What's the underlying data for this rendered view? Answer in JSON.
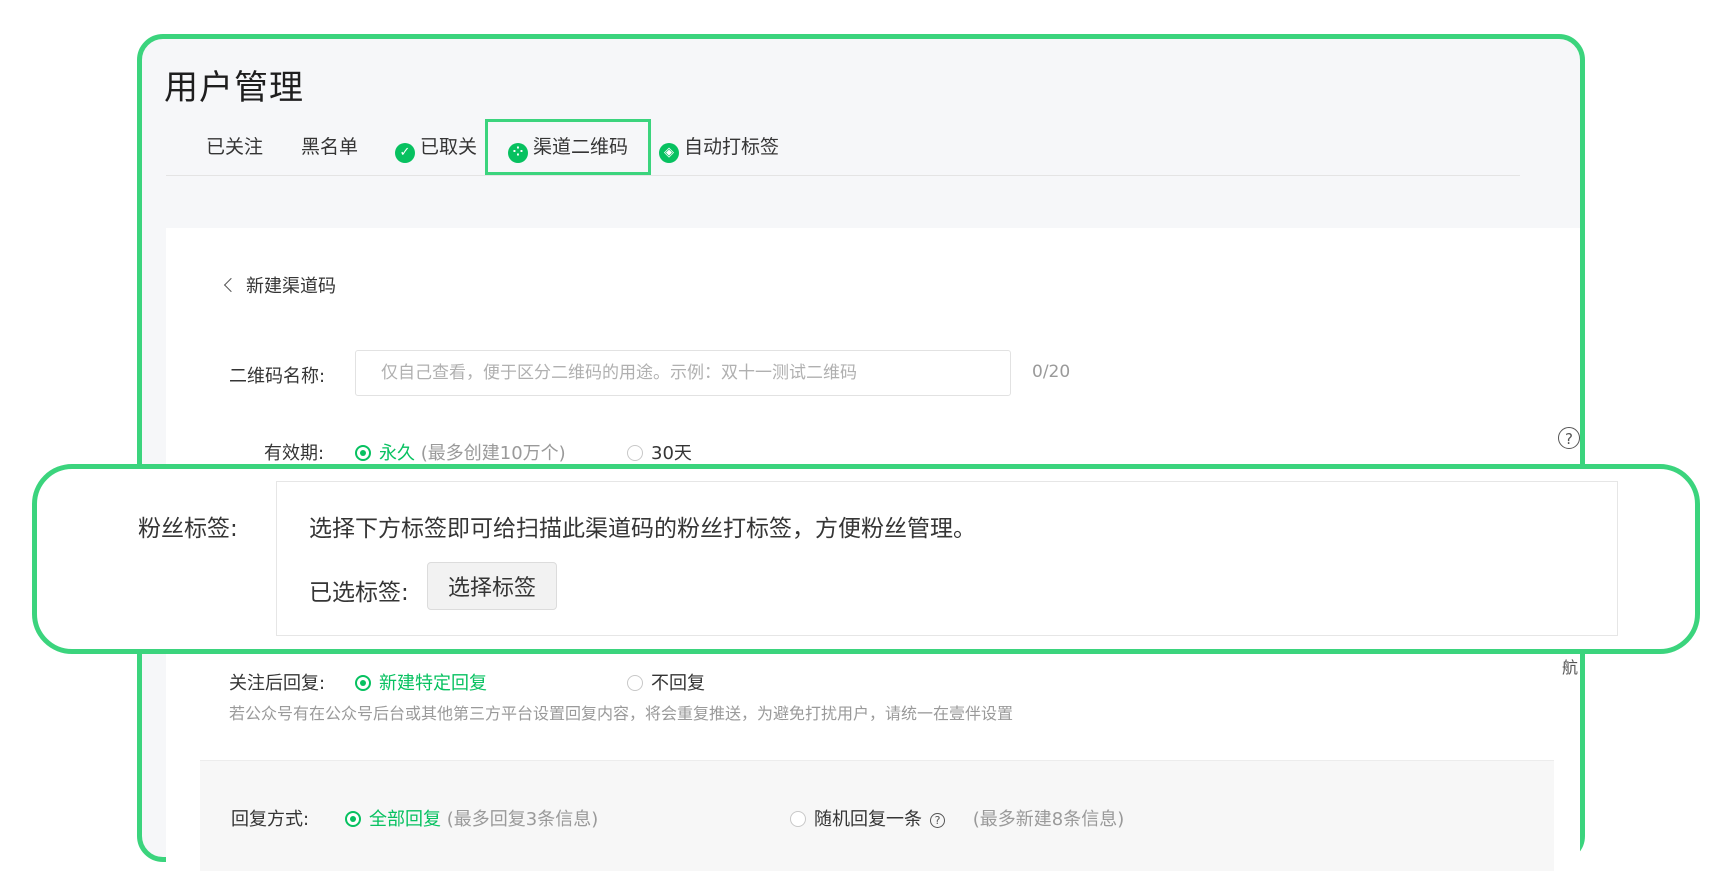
{
  "page": {
    "title": "用户管理"
  },
  "tabs": [
    {
      "label": "已关注",
      "icon": ""
    },
    {
      "label": "黑名单",
      "icon": ""
    },
    {
      "label": "已取关",
      "icon": "check-badge-icon"
    },
    {
      "label": "渠道二维码",
      "icon": "qr-grid-icon"
    },
    {
      "label": "自动打标签",
      "icon": "tag-icon"
    }
  ],
  "back": {
    "label": "新建渠道码"
  },
  "qr_name": {
    "label": "二维码名称:",
    "placeholder": "仅自己查看，便于区分二维码的用途。示例：双十一测试二维码",
    "value": "",
    "counter": "0/20"
  },
  "validity": {
    "label": "有效期:",
    "options": [
      {
        "label": "永久",
        "hint": "(最多创建10万个)",
        "selected": true
      },
      {
        "label": "30天",
        "hint": "",
        "selected": false
      }
    ]
  },
  "fan_tags": {
    "label": "粉丝标签:",
    "description": "选择下方标签即可给扫描此渠道码的粉丝打标签，方便粉丝管理。",
    "selected_label": "已选标签:",
    "select_button": "选择标签"
  },
  "after_follow": {
    "label": "关注后回复:",
    "options": [
      {
        "label": "新建特定回复",
        "selected": true
      },
      {
        "label": "不回复",
        "selected": false
      }
    ],
    "note": "若公众号有在公众号后台或其他第三方平台设置回复内容，将会重复推送，为避免打扰用户，请统一在壹伴设置"
  },
  "reply_mode": {
    "label": "回复方式:",
    "options": [
      {
        "label": "全部回复",
        "hint": "(最多回复3条信息)",
        "selected": true
      },
      {
        "label": "随机回复一条",
        "hint": "(最多新建8条信息)",
        "selected": false
      }
    ]
  },
  "side": {
    "help_glyph": "?",
    "nav_text": "航"
  },
  "colors": {
    "accent": "#07c160",
    "highlight_border": "#3bd47d"
  }
}
